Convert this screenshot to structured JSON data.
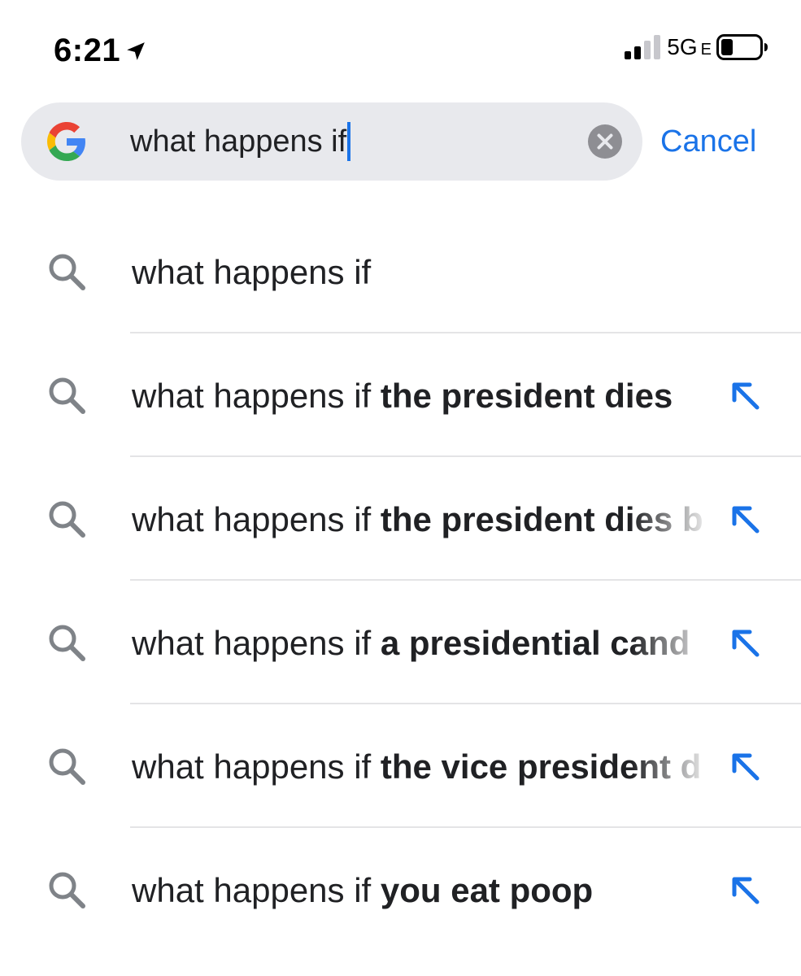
{
  "status_bar": {
    "time": "6:21",
    "network": "5G",
    "network_sub": "E",
    "icons": [
      "location-arrow-icon",
      "signal-bars-icon",
      "battery-icon"
    ]
  },
  "search": {
    "query": "what happens if",
    "cancel_label": "Cancel",
    "icons": [
      "google-logo-icon",
      "clear-icon"
    ]
  },
  "suggestions": [
    {
      "prefix": "what happens if",
      "completion": "",
      "has_fill_arrow": false
    },
    {
      "prefix": "what happens if ",
      "completion": "the president dies",
      "has_fill_arrow": true
    },
    {
      "prefix": "what happens if ",
      "completion": "the president dies b",
      "has_fill_arrow": true
    },
    {
      "prefix": "what happens if ",
      "completion": "a presidential cand",
      "has_fill_arrow": true
    },
    {
      "prefix": "what happens if ",
      "completion": "the vice president d",
      "has_fill_arrow": true
    },
    {
      "prefix": "what happens if ",
      "completion": "you eat poop",
      "has_fill_arrow": true
    }
  ],
  "colors": {
    "accent": "#1a73e8",
    "search_bg": "#e8e9ed",
    "icon_gray": "#7f8388",
    "divider": "#e4e4e6",
    "text": "#202124"
  }
}
